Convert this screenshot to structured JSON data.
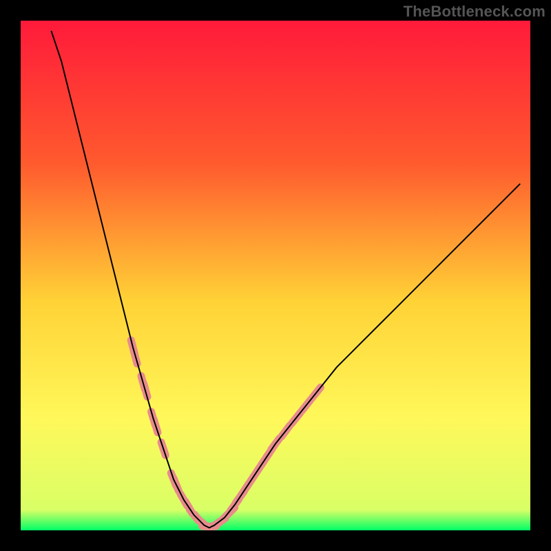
{
  "watermark": "TheBottleneck.com",
  "chart_data": {
    "type": "line",
    "title": "",
    "xlabel": "",
    "ylabel": "",
    "xlim": [
      0,
      100
    ],
    "ylim": [
      0,
      100
    ],
    "gradient_stops": [
      {
        "offset": 0,
        "color": "#ff1a3a"
      },
      {
        "offset": 28,
        "color": "#ff5a2e"
      },
      {
        "offset": 55,
        "color": "#ffd236"
      },
      {
        "offset": 78,
        "color": "#fff85a"
      },
      {
        "offset": 96,
        "color": "#d9ff66"
      },
      {
        "offset": 100,
        "color": "#00ff66"
      }
    ],
    "curve": {
      "description": "V-shaped bottleneck curve; y is roughly proportional to |x - 37|^1.5, minimum at x≈37",
      "min_x": 37,
      "points": [
        {
          "x": 6,
          "y": 98
        },
        {
          "x": 8,
          "y": 92
        },
        {
          "x": 10,
          "y": 84
        },
        {
          "x": 12,
          "y": 76
        },
        {
          "x": 14,
          "y": 68
        },
        {
          "x": 16,
          "y": 60
        },
        {
          "x": 18,
          "y": 52
        },
        {
          "x": 20,
          "y": 44
        },
        {
          "x": 22,
          "y": 36
        },
        {
          "x": 24,
          "y": 29
        },
        {
          "x": 26,
          "y": 22
        },
        {
          "x": 28,
          "y": 16
        },
        {
          "x": 30,
          "y": 10
        },
        {
          "x": 32,
          "y": 6
        },
        {
          "x": 34,
          "y": 3
        },
        {
          "x": 36,
          "y": 1
        },
        {
          "x": 37,
          "y": 0.5
        },
        {
          "x": 38,
          "y": 1
        },
        {
          "x": 40,
          "y": 2.5
        },
        {
          "x": 42,
          "y": 5
        },
        {
          "x": 44,
          "y": 8
        },
        {
          "x": 46,
          "y": 11
        },
        {
          "x": 48,
          "y": 14
        },
        {
          "x": 50,
          "y": 17
        },
        {
          "x": 54,
          "y": 22
        },
        {
          "x": 58,
          "y": 27
        },
        {
          "x": 62,
          "y": 32
        },
        {
          "x": 66,
          "y": 36
        },
        {
          "x": 70,
          "y": 40
        },
        {
          "x": 74,
          "y": 44
        },
        {
          "x": 78,
          "y": 48
        },
        {
          "x": 82,
          "y": 52
        },
        {
          "x": 86,
          "y": 56
        },
        {
          "x": 90,
          "y": 60
        },
        {
          "x": 94,
          "y": 64
        },
        {
          "x": 98,
          "y": 68
        }
      ],
      "highlight_points": [
        {
          "x": 22,
          "y": 36
        },
        {
          "x": 22.5,
          "y": 34
        },
        {
          "x": 24,
          "y": 29
        },
        {
          "x": 24.5,
          "y": 27.5
        },
        {
          "x": 26,
          "y": 22
        },
        {
          "x": 26.5,
          "y": 20.5
        },
        {
          "x": 28,
          "y": 16
        },
        {
          "x": 30,
          "y": 10
        },
        {
          "x": 30.5,
          "y": 9
        },
        {
          "x": 32,
          "y": 6
        },
        {
          "x": 33,
          "y": 4.5
        },
        {
          "x": 34,
          "y": 3
        },
        {
          "x": 35,
          "y": 2
        },
        {
          "x": 36,
          "y": 1.2
        },
        {
          "x": 37,
          "y": 0.8
        },
        {
          "x": 38,
          "y": 1
        },
        {
          "x": 39,
          "y": 1.6
        },
        {
          "x": 40,
          "y": 2.5
        },
        {
          "x": 41,
          "y": 3.5
        },
        {
          "x": 42,
          "y": 5
        },
        {
          "x": 43,
          "y": 6.5
        },
        {
          "x": 44,
          "y": 8
        },
        {
          "x": 45,
          "y": 9.5
        },
        {
          "x": 46,
          "y": 11
        },
        {
          "x": 47,
          "y": 12.5
        },
        {
          "x": 48,
          "y": 14
        },
        {
          "x": 49,
          "y": 15.5
        },
        {
          "x": 50,
          "y": 17
        },
        {
          "x": 52,
          "y": 19.5
        },
        {
          "x": 54,
          "y": 22
        },
        {
          "x": 56,
          "y": 24.5
        },
        {
          "x": 58,
          "y": 27
        }
      ]
    }
  }
}
